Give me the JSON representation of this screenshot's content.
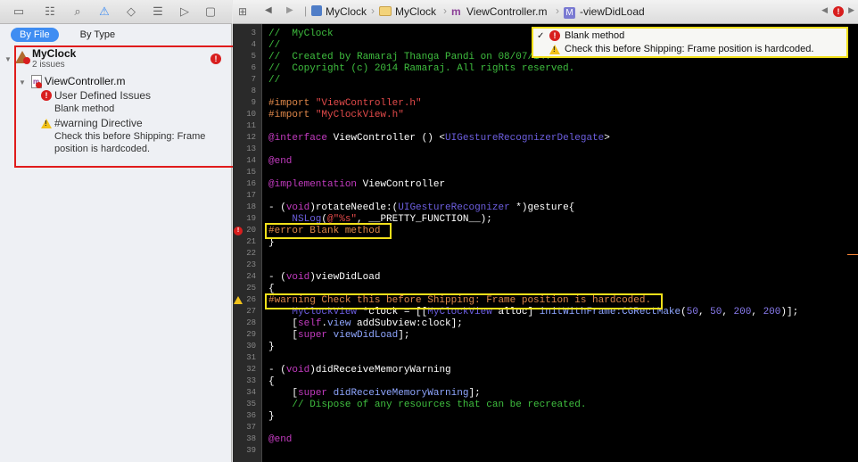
{
  "navigator": {
    "filter": {
      "by_file": "By File",
      "by_type": "By Type"
    },
    "project": {
      "name": "MyClock",
      "issue_count": "2 issues"
    },
    "file": {
      "name": "ViewController.m"
    },
    "groups": [
      {
        "title": "User Defined Issues",
        "detail": "Blank method",
        "kind": "error"
      },
      {
        "title": "#warning Directive",
        "detail_line1": "Check this before Shipping: Frame",
        "detail_line2": "position is hardcoded.",
        "kind": "warning"
      }
    ]
  },
  "jumpbar": {
    "project": "MyClock",
    "folder": "MyClock",
    "file": "ViewController.m",
    "method": "-viewDidLoad"
  },
  "popup": {
    "items": [
      {
        "label": "Blank method",
        "kind": "error",
        "checked": true
      },
      {
        "label": "Check this before Shipping: Frame position is hardcoded.",
        "kind": "warning",
        "checked": false
      }
    ]
  },
  "code": {
    "lines": [
      {
        "n": "3",
        "text": "//  MyClock"
      },
      {
        "n": "4",
        "text": "//"
      },
      {
        "n": "5",
        "text": "//  Created by Ramaraj Thanga Pandi on 08/07/14."
      },
      {
        "n": "6",
        "text": "//  Copyright (c) 2014 Ramaraj. All rights reserved."
      },
      {
        "n": "7",
        "text": "//"
      },
      {
        "n": "8",
        "text": ""
      },
      {
        "n": "9",
        "text_a": "#import ",
        "text_b": "\"ViewController.h\""
      },
      {
        "n": "10",
        "text_a": "#import ",
        "text_b": "\"MyClockView.h\""
      },
      {
        "n": "11",
        "text": ""
      },
      {
        "n": "12",
        "text_a": "@interface",
        "text_b": " ViewController () <",
        "text_c": "UIGestureRecognizerDelegate",
        "text_d": ">"
      },
      {
        "n": "13",
        "text": ""
      },
      {
        "n": "14",
        "text": "@end"
      },
      {
        "n": "15",
        "text": ""
      },
      {
        "n": "16",
        "text_a": "@implementation",
        "text_b": " ViewController"
      },
      {
        "n": "17",
        "text": ""
      },
      {
        "n": "18",
        "text_a": "- (",
        "text_b": "void",
        "text_c": ")rotateNeedle:(",
        "text_d": "UIGestureRecognizer",
        "text_e": " *)gesture{"
      },
      {
        "n": "19",
        "text_a": "    NSLog",
        "text_b": "(",
        "text_c": "@\"%s\"",
        "text_d": ", __PRETTY_FUNCTION__);"
      },
      {
        "n": "20",
        "text": "#error Blank method"
      },
      {
        "n": "21",
        "text": "}"
      },
      {
        "n": "22",
        "text": ""
      },
      {
        "n": "23",
        "text": ""
      },
      {
        "n": "24",
        "text_a": "- (",
        "text_b": "void",
        "text_c": ")viewDidLoad"
      },
      {
        "n": "25",
        "text": "{"
      },
      {
        "n": "26",
        "text": "#warning Check this before Shipping: Frame position is hardcoded."
      },
      {
        "n": "27",
        "text_a": "    MyClockView",
        "text_b": " *clock = [[",
        "text_c": "MyClockView",
        "text_d": " alloc] ",
        "text_e": "initWithFrame:",
        "text_f": "CGRectMake",
        "text_g": "(",
        "num1": "50",
        "num2": "50",
        "num3": "200",
        "num4": "200",
        "text_h": ")];"
      },
      {
        "n": "28",
        "text_a": "    [",
        "text_b": "self",
        "text_c": ".",
        "text_d": "view",
        "text_e": " addSubview:clock];"
      },
      {
        "n": "29",
        "text_a": "    [",
        "text_b": "super",
        "text_c": " ",
        "text_d": "viewDidLoad",
        "text_e": "];"
      },
      {
        "n": "30",
        "text": "}"
      },
      {
        "n": "31",
        "text": ""
      },
      {
        "n": "32",
        "text_a": "- (",
        "text_b": "void",
        "text_c": ")didReceiveMemoryWarning"
      },
      {
        "n": "33",
        "text": "{"
      },
      {
        "n": "34",
        "text_a": "    [",
        "text_b": "super",
        "text_c": " ",
        "text_d": "didReceiveMemoryWarning",
        "text_e": "];"
      },
      {
        "n": "35",
        "text": "    // Dispose of any resources that can be recreated."
      },
      {
        "n": "36",
        "text": "}"
      },
      {
        "n": "37",
        "text": ""
      },
      {
        "n": "38",
        "text": "@end"
      },
      {
        "n": "39",
        "text": ""
      }
    ]
  },
  "colors": {
    "error": "#d81e1e",
    "warning": "#f2c21a",
    "highlight_yellow": "#f2e01a",
    "highlight_red": "#e01b1b",
    "accent": "#3f8df2"
  }
}
